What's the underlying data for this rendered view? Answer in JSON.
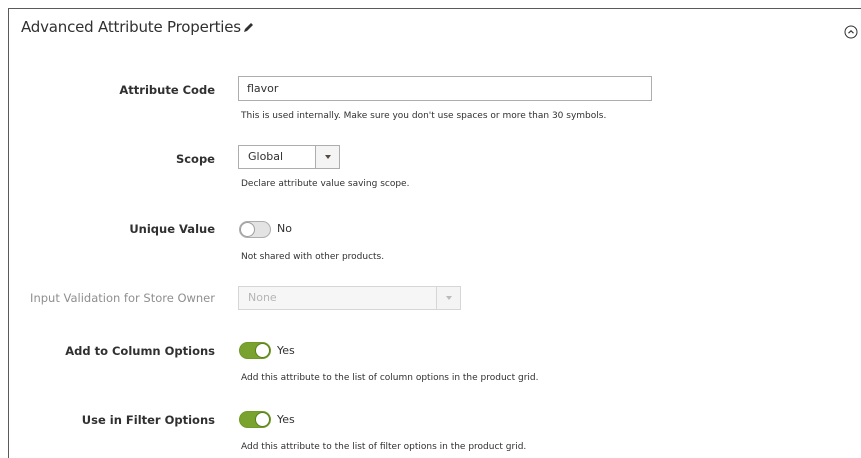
{
  "section": {
    "title": "Advanced Attribute Properties"
  },
  "fields": {
    "attribute_code": {
      "label": "Attribute Code",
      "value": "flavor",
      "note": "This is used internally. Make sure you don't use spaces or more than 30 symbols."
    },
    "scope": {
      "label": "Scope",
      "value": "Global",
      "note": "Declare attribute value saving scope."
    },
    "unique_value": {
      "label": "Unique Value",
      "state": "No",
      "note": "Not shared with other products."
    },
    "input_validation": {
      "label": "Input Validation for Store Owner",
      "value": "None"
    },
    "add_to_column_options": {
      "label": "Add to Column Options",
      "state": "Yes",
      "note": "Add this attribute to the list of column options in the product grid."
    },
    "use_in_filter_options": {
      "label": "Use in Filter Options",
      "state": "Yes",
      "note": "Add this attribute to the list of filter options in the product grid."
    }
  },
  "colors": {
    "toggle_on": "#79a22e",
    "toggle_off": "#e3e3e3"
  },
  "icons": {
    "edit": "pencil-icon",
    "collapse": "collapse-circle-icon",
    "dropdown": "caret-down-icon"
  }
}
